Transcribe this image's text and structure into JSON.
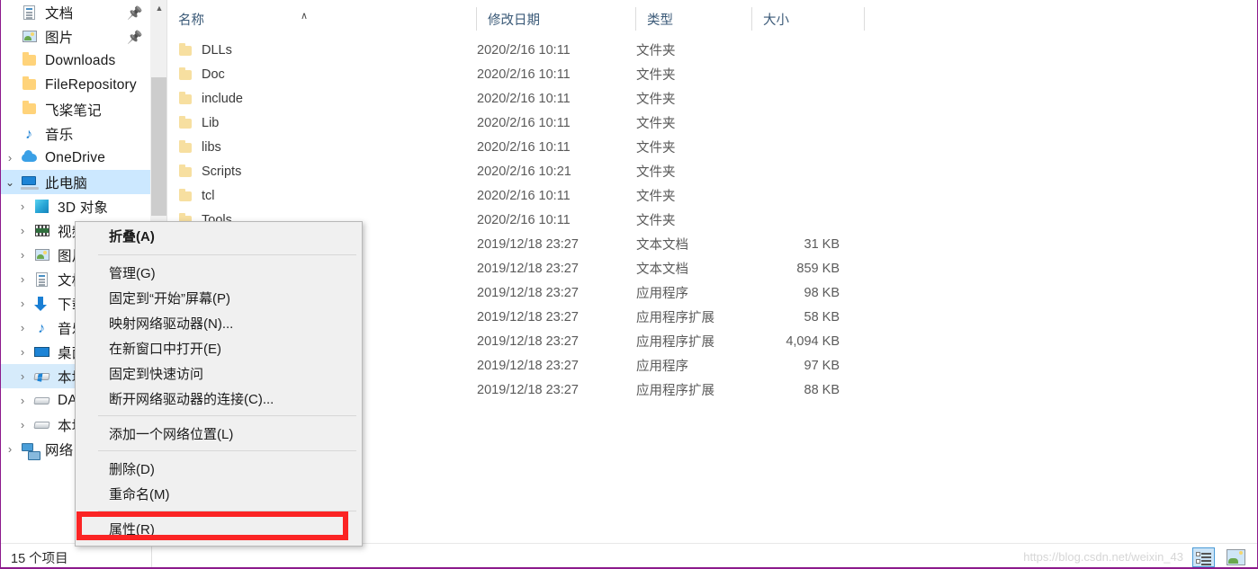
{
  "sidebar": {
    "items": [
      {
        "label": "文档",
        "icon": "document-icon",
        "chevron": "none",
        "pinned": true,
        "indent": 0,
        "selected": false
      },
      {
        "label": "图片",
        "icon": "picture-icon",
        "chevron": "none",
        "pinned": true,
        "indent": 0,
        "selected": false
      },
      {
        "label": "Downloads",
        "icon": "folder-icon",
        "chevron": "none",
        "pinned": false,
        "indent": 0,
        "selected": false
      },
      {
        "label": "FileRepository",
        "icon": "folder-icon",
        "chevron": "none",
        "pinned": false,
        "indent": 0,
        "selected": false
      },
      {
        "label": "飞桨笔记",
        "icon": "folder-icon",
        "chevron": "none",
        "pinned": false,
        "indent": 0,
        "selected": false
      },
      {
        "label": "音乐",
        "icon": "music-icon",
        "chevron": "none",
        "pinned": false,
        "indent": 0,
        "selected": false
      },
      {
        "label": "OneDrive",
        "icon": "cloud-icon",
        "chevron": "right",
        "pinned": false,
        "indent": 0,
        "selected": false
      },
      {
        "label": "此电脑",
        "icon": "this-pc-icon",
        "chevron": "down",
        "pinned": false,
        "indent": 0,
        "selected": true
      },
      {
        "label": "3D 对象",
        "icon": "3d-objects-icon",
        "chevron": "right",
        "pinned": false,
        "indent": 1,
        "selected": false
      },
      {
        "label": "视频",
        "icon": "video-icon",
        "chevron": "right",
        "pinned": false,
        "indent": 1,
        "selected": false
      },
      {
        "label": "图片",
        "icon": "picture-icon",
        "chevron": "right",
        "pinned": false,
        "indent": 1,
        "selected": false
      },
      {
        "label": "文档",
        "icon": "document-icon",
        "chevron": "right",
        "pinned": false,
        "indent": 1,
        "selected": false
      },
      {
        "label": "下载",
        "icon": "download-icon",
        "chevron": "right",
        "pinned": false,
        "indent": 1,
        "selected": false
      },
      {
        "label": "音乐",
        "icon": "music-icon",
        "chevron": "right",
        "pinned": false,
        "indent": 1,
        "selected": false
      },
      {
        "label": "桌面",
        "icon": "desktop-icon",
        "chevron": "right",
        "pinned": false,
        "indent": 1,
        "selected": false
      },
      {
        "label": "本地磁盘 (C:)",
        "icon": "windows-drive-icon",
        "chevron": "right",
        "pinned": false,
        "indent": 1,
        "selected": "soft"
      },
      {
        "label": "DATA (D:)",
        "icon": "drive-icon",
        "chevron": "right",
        "pinned": false,
        "indent": 1,
        "selected": false
      },
      {
        "label": "本地磁盘 (E:)",
        "icon": "drive-icon",
        "chevron": "right",
        "pinned": false,
        "indent": 1,
        "selected": false
      },
      {
        "label": "网络",
        "icon": "network-icon",
        "chevron": "right",
        "pinned": false,
        "indent": 0,
        "selected": false
      }
    ]
  },
  "filelist": {
    "columns": [
      {
        "label": "名称",
        "name": "column-name"
      },
      {
        "label": "修改日期",
        "name": "column-date-modified"
      },
      {
        "label": "类型",
        "name": "column-type"
      },
      {
        "label": "大小",
        "name": "column-size"
      }
    ],
    "sort": {
      "column": "名称",
      "direction": "ascending",
      "glyph": "∧"
    },
    "rows": [
      {
        "name": "DLLs",
        "icon": "folder-icon",
        "date": "2020/2/16 10:11",
        "type": "文件夹",
        "size": ""
      },
      {
        "name": "Doc",
        "icon": "folder-icon",
        "date": "2020/2/16 10:11",
        "type": "文件夹",
        "size": ""
      },
      {
        "name": "include",
        "icon": "folder-icon",
        "date": "2020/2/16 10:11",
        "type": "文件夹",
        "size": ""
      },
      {
        "name": "Lib",
        "icon": "folder-icon",
        "date": "2020/2/16 10:11",
        "type": "文件夹",
        "size": ""
      },
      {
        "name": "libs",
        "icon": "folder-icon",
        "date": "2020/2/16 10:11",
        "type": "文件夹",
        "size": ""
      },
      {
        "name": "Scripts",
        "icon": "folder-icon",
        "date": "2020/2/16 10:21",
        "type": "文件夹",
        "size": ""
      },
      {
        "name": "tcl",
        "icon": "folder-icon",
        "date": "2020/2/16 10:11",
        "type": "文件夹",
        "size": ""
      },
      {
        "name": "Tools",
        "icon": "folder-icon",
        "date": "2020/2/16 10:11",
        "type": "文件夹",
        "size": ""
      },
      {
        "name": "",
        "icon": "",
        "date": "2019/12/18 23:27",
        "type": "文本文档",
        "size": "31 KB"
      },
      {
        "name": "",
        "icon": "",
        "date": "2019/12/18 23:27",
        "type": "文本文档",
        "size": "859 KB"
      },
      {
        "name": "",
        "icon": "",
        "date": "2019/12/18 23:27",
        "type": "应用程序",
        "size": "98 KB"
      },
      {
        "name": "",
        "icon": "",
        "date": "2019/12/18 23:27",
        "type": "应用程序扩展",
        "size": "58 KB"
      },
      {
        "name": "",
        "icon": "",
        "date": "2019/12/18 23:27",
        "type": "应用程序扩展",
        "size": "4,094 KB"
      },
      {
        "name": "",
        "icon": "",
        "date": "2019/12/18 23:27",
        "type": "应用程序",
        "size": "97 KB"
      },
      {
        "name": "",
        "icon": "",
        "date": "2019/12/18 23:27",
        "type": "应用程序扩展",
        "size": "88 KB"
      }
    ]
  },
  "context_menu": {
    "items": [
      {
        "label": "折叠(A)",
        "bold": true,
        "name": "ctx-collapse"
      },
      {
        "separator": true
      },
      {
        "label": "管理(G)",
        "bold": false,
        "name": "ctx-manage"
      },
      {
        "label": "固定到“开始”屏幕(P)",
        "bold": false,
        "name": "ctx-pin-to-start"
      },
      {
        "label": "映射网络驱动器(N)...",
        "bold": false,
        "name": "ctx-map-network-drive"
      },
      {
        "label": "在新窗口中打开(E)",
        "bold": false,
        "name": "ctx-open-new-window"
      },
      {
        "label": "固定到快速访问",
        "bold": false,
        "name": "ctx-pin-to-quick-access"
      },
      {
        "label": "断开网络驱动器的连接(C)...",
        "bold": false,
        "name": "ctx-disconnect-network-drive"
      },
      {
        "separator": true
      },
      {
        "label": "添加一个网络位置(L)",
        "bold": false,
        "name": "ctx-add-network-location"
      },
      {
        "separator": true
      },
      {
        "label": "删除(D)",
        "bold": false,
        "name": "ctx-delete"
      },
      {
        "label": "重命名(M)",
        "bold": false,
        "name": "ctx-rename"
      },
      {
        "separator": true
      },
      {
        "label": "属性(R)",
        "bold": false,
        "name": "ctx-properties",
        "highlighted": true
      }
    ],
    "highlight_color": "#fb2424"
  },
  "statusbar": {
    "item_count": "15 个项目",
    "watermark": "https://blog.csdn.net/weixin_43",
    "views": [
      {
        "name": "view-details-button",
        "selected": true
      },
      {
        "name": "view-large-icons-button",
        "selected": false
      }
    ]
  },
  "colors": {
    "selection_blue": "#cce8ff",
    "soft_selection": "#d6ebfb",
    "menu_bg": "#f0f0f0",
    "header_text": "#3b5a78",
    "highlight_red": "#fb2424",
    "bottom_border": "#8c1a8c"
  }
}
